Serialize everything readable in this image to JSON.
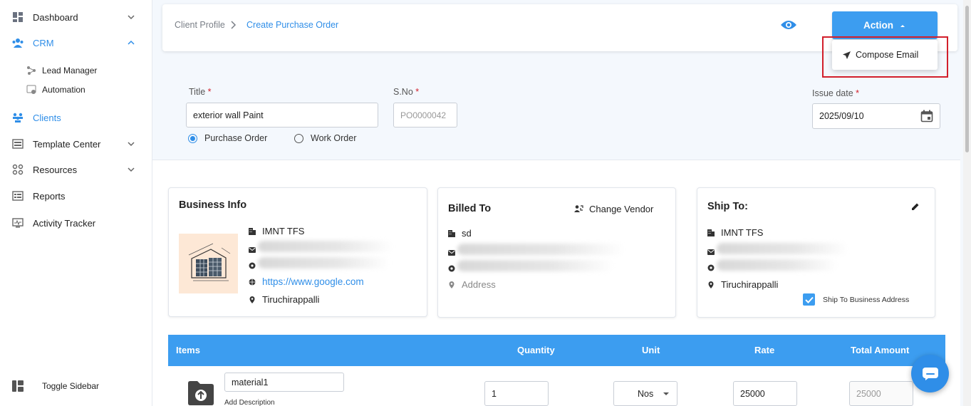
{
  "sidebar": {
    "items": [
      {
        "label": "Dashboard",
        "icon": "dashboard-icon"
      },
      {
        "label": "CRM",
        "icon": "crm-icon"
      },
      {
        "label": "Lead Manager",
        "icon": "lead-manager-icon"
      },
      {
        "label": "Automation",
        "icon": "automation-icon"
      },
      {
        "label": "Clients",
        "icon": "clients-icon"
      },
      {
        "label": "Template Center",
        "icon": "template-icon"
      },
      {
        "label": "Resources",
        "icon": "resources-icon"
      },
      {
        "label": "Reports",
        "icon": "reports-icon"
      },
      {
        "label": "Activity Tracker",
        "icon": "activity-icon"
      }
    ],
    "toggle_label": "Toggle Sidebar"
  },
  "breadcrumb": {
    "parent": "Client Profile",
    "current": "Create Purchase Order"
  },
  "header": {
    "action_label": "Action",
    "dropdown_item": "Compose Email"
  },
  "form": {
    "title_label": "Title",
    "title_value": "exterior wall Paint",
    "sno_label": "S.No",
    "sno_placeholder": "PO0000042",
    "issue_date_label": "Issue date",
    "issue_date_value": "2025/09/10",
    "order_types": [
      "Purchase Order",
      "Work Order"
    ],
    "selected_order_type": "Purchase Order"
  },
  "business_info": {
    "title": "Business Info",
    "name": "IMNT TFS",
    "website": "https://www.google.com",
    "location": "Tiruchirappalli"
  },
  "billed_to": {
    "title": "Billed To",
    "change_vendor_label": "Change Vendor",
    "name": "sd",
    "address_placeholder": "Address"
  },
  "ship_to": {
    "title": "Ship To:",
    "name": "IMNT TFS",
    "location": "Tiruchirappalli",
    "ship_to_business_label": "Ship To Business Address",
    "ship_to_business_checked": true
  },
  "items_table": {
    "headers": [
      "Items",
      "Quantity",
      "Unit",
      "Rate",
      "Total Amount"
    ],
    "rows": [
      {
        "name": "material1",
        "add_description": "Add Description",
        "quantity": "1",
        "unit": "Nos",
        "rate": "25000",
        "total": "25000"
      }
    ]
  },
  "colors": {
    "primary": "#3c9df0",
    "accent_link": "#2f8ee8",
    "required": "#d21f2b",
    "highlight_border": "#d21f2b"
  }
}
